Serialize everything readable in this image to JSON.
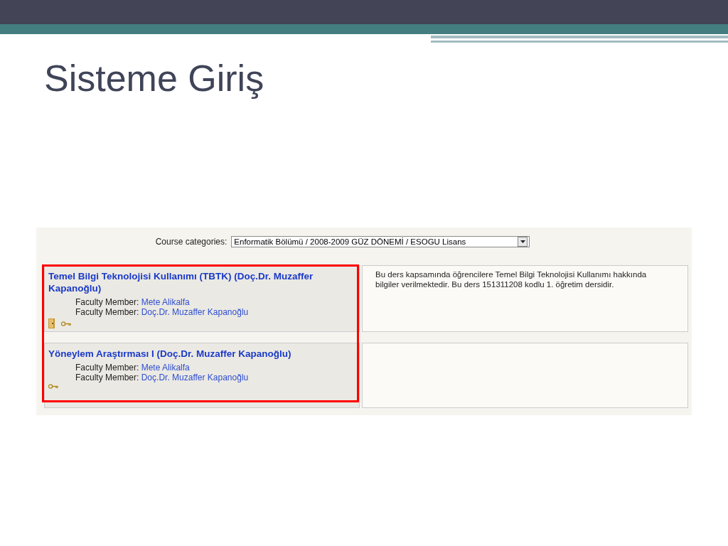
{
  "slide": {
    "title": "Sisteme Giriş"
  },
  "course_categories": {
    "label": "Course categories:",
    "value": "Enformatik Bölümü / 2008-2009 GÜZ DÖNEMİ / ESOGU Lisans"
  },
  "courses": [
    {
      "name": "Temel Bilgi Teknolojisi Kullanımı (TBTK) (Doç.Dr. Muzaffer Kapanoğlu)",
      "faculty": [
        {
          "label": "Faculty Member:",
          "name": "Mete Alikalfa"
        },
        {
          "label": "Faculty Member:",
          "name": "Doç.Dr. Muzaffer Kapanoğlu"
        }
      ],
      "guest_access": true,
      "enrolment_key": true,
      "description": "Bu ders kapsamında öğrencilere Temel Bilgi Teknolojisi Kullanımı hakkında bilgiler verilmektedir. Bu ders 151311208 kodlu 1. öğretim dersidir."
    },
    {
      "name": "Yöneylem Araştırması I (Doç.Dr. Muzaffer Kapanoğlu)",
      "faculty": [
        {
          "label": "Faculty Member:",
          "name": "Mete Alikalfa"
        },
        {
          "label": "Faculty Member:",
          "name": "Doç.Dr. Muzaffer Kapanoğlu"
        }
      ],
      "guest_access": false,
      "enrolment_key": true
    }
  ]
}
